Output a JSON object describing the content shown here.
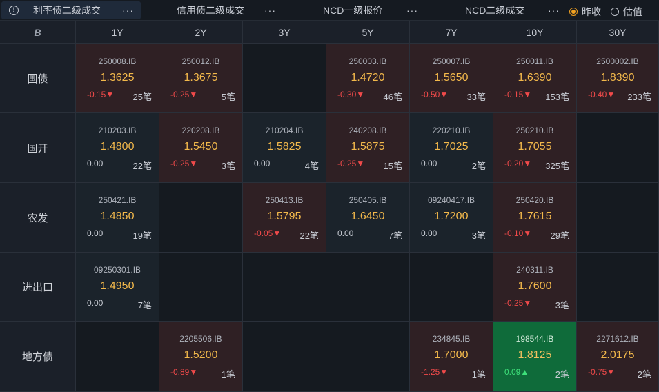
{
  "tabs": [
    {
      "label": "利率债二级成交",
      "more": "···",
      "active": true
    },
    {
      "label": "信用债二级成交",
      "more": "···"
    },
    {
      "label": "NCD一级报价",
      "more": "···"
    },
    {
      "label": "NCD二级成交",
      "more": "···"
    }
  ],
  "radios": [
    {
      "label": "昨收",
      "checked": true
    },
    {
      "label": "估值",
      "checked": false
    }
  ],
  "corner": "B",
  "columns": [
    "1Y",
    "2Y",
    "3Y",
    "5Y",
    "7Y",
    "10Y",
    "30Y"
  ],
  "rows": [
    {
      "name": "国债",
      "cells": [
        {
          "code": "250008.IB",
          "price": "1.3625",
          "chg": "-0.15▼",
          "cnt": "25笔",
          "state": "down"
        },
        {
          "code": "250012.IB",
          "price": "1.3675",
          "chg": "-0.25▼",
          "cnt": "5笔",
          "state": "down"
        },
        null,
        {
          "code": "250003.IB",
          "price": "1.4720",
          "chg": "-0.30▼",
          "cnt": "46笔",
          "state": "down"
        },
        {
          "code": "250007.IB",
          "price": "1.5650",
          "chg": "-0.50▼",
          "cnt": "33笔",
          "state": "down"
        },
        {
          "code": "250011.IB",
          "price": "1.6390",
          "chg": "-0.15▼",
          "cnt": "153笔",
          "state": "down"
        },
        {
          "code": "2500002.IB",
          "price": "1.8390",
          "chg": "-0.40▼",
          "cnt": "233笔",
          "state": "down"
        }
      ]
    },
    {
      "name": "国开",
      "cells": [
        {
          "code": "210203.IB",
          "price": "1.4800",
          "chg": "0.00",
          "cnt": "22笔",
          "state": "flat"
        },
        {
          "code": "220208.IB",
          "price": "1.5450",
          "chg": "-0.25▼",
          "cnt": "3笔",
          "state": "down"
        },
        {
          "code": "210204.IB",
          "price": "1.5825",
          "chg": "0.00",
          "cnt": "4笔",
          "state": "flat"
        },
        {
          "code": "240208.IB",
          "price": "1.5875",
          "chg": "-0.25▼",
          "cnt": "15笔",
          "state": "down"
        },
        {
          "code": "220210.IB",
          "price": "1.7025",
          "chg": "0.00",
          "cnt": "2笔",
          "state": "flat"
        },
        {
          "code": "250210.IB",
          "price": "1.7055",
          "chg": "-0.20▼",
          "cnt": "325笔",
          "state": "down"
        },
        null
      ]
    },
    {
      "name": "农发",
      "cells": [
        {
          "code": "250421.IB",
          "price": "1.4850",
          "chg": "0.00",
          "cnt": "19笔",
          "state": "flat"
        },
        null,
        {
          "code": "250413.IB",
          "price": "1.5795",
          "chg": "-0.05▼",
          "cnt": "22笔",
          "state": "down"
        },
        {
          "code": "250405.IB",
          "price": "1.6450",
          "chg": "0.00",
          "cnt": "7笔",
          "state": "flat"
        },
        {
          "code": "09240417.IB",
          "price": "1.7200",
          "chg": "0.00",
          "cnt": "3笔",
          "state": "flat"
        },
        {
          "code": "250420.IB",
          "price": "1.7615",
          "chg": "-0.10▼",
          "cnt": "29笔",
          "state": "down"
        },
        null
      ]
    },
    {
      "name": "进出口",
      "cells": [
        {
          "code": "09250301.IB",
          "price": "1.4950",
          "chg": "0.00",
          "cnt": "7笔",
          "state": "flat"
        },
        null,
        null,
        null,
        null,
        {
          "code": "240311.IB",
          "price": "1.7600",
          "chg": "-0.25▼",
          "cnt": "3笔",
          "state": "down"
        },
        null
      ]
    },
    {
      "name": "地方债",
      "cells": [
        null,
        {
          "code": "2205506.IB",
          "price": "1.5200",
          "chg": "-0.89▼",
          "cnt": "1笔",
          "state": "down"
        },
        null,
        null,
        {
          "code": "234845.IB",
          "price": "1.7000",
          "chg": "-1.25▼",
          "cnt": "1笔",
          "state": "down"
        },
        {
          "code": "198544.IB",
          "price": "1.8125",
          "chg": "0.09▲",
          "cnt": "2笔",
          "state": "up"
        },
        {
          "code": "2271612.IB",
          "price": "2.0175",
          "chg": "-0.75▼",
          "cnt": "2笔",
          "state": "down"
        }
      ]
    }
  ]
}
